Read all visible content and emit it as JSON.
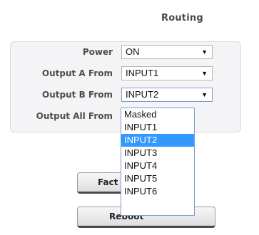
{
  "title": "Routing",
  "rows": [
    {
      "label": "Power",
      "value": "ON"
    },
    {
      "label": "Output A From",
      "value": "INPUT1"
    },
    {
      "label": "Output B From",
      "value": "INPUT2"
    },
    {
      "label": "Output All From",
      "value": ""
    }
  ],
  "buttons": {
    "factory_partial": "Fact",
    "reboot_partial": "Reboot"
  },
  "dropdown": {
    "options": [
      "Masked",
      "INPUT1",
      "INPUT2",
      "INPUT3",
      "INPUT4",
      "INPUT5",
      "INPUT6"
    ],
    "selected": "INPUT2"
  },
  "icons": {
    "select_arrow": "caret-down-icon"
  },
  "colors": {
    "selected_bg": "#3399ff",
    "panel_bg": "#f4f4f6"
  }
}
